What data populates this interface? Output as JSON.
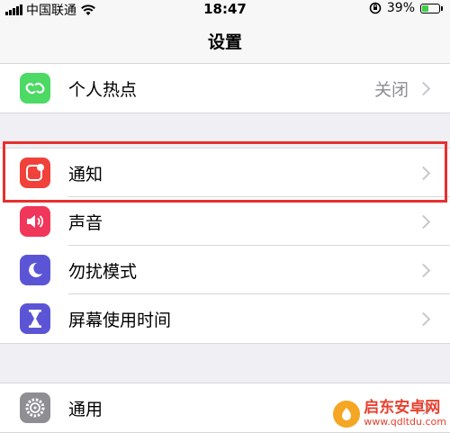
{
  "status_bar": {
    "carrier": "中国联通",
    "time": "18:47",
    "battery_percent": "39%",
    "battery_level": 0.39
  },
  "header": {
    "title": "设置"
  },
  "groups": [
    {
      "items": [
        {
          "label": "个人热点",
          "detail": "关闭",
          "icon": "hotspot-icon",
          "color": "#4cd964"
        }
      ]
    },
    {
      "items": [
        {
          "label": "通知",
          "icon": "notifications-icon",
          "color": "#f0413a"
        },
        {
          "label": "声音",
          "icon": "sounds-icon",
          "color": "#f0365a"
        },
        {
          "label": "勿扰模式",
          "icon": "do-not-disturb-icon",
          "color": "#5b55d6"
        },
        {
          "label": "屏幕使用时间",
          "icon": "screen-time-icon",
          "color": "#5b55d6"
        }
      ]
    },
    {
      "items": [
        {
          "label": "通用",
          "icon": "general-gear-icon",
          "color": "#8e8e93"
        }
      ]
    }
  ],
  "highlight_color": "#e8302e",
  "watermark": {
    "title": "启东安卓网",
    "url": "www.qdltdu.com"
  }
}
